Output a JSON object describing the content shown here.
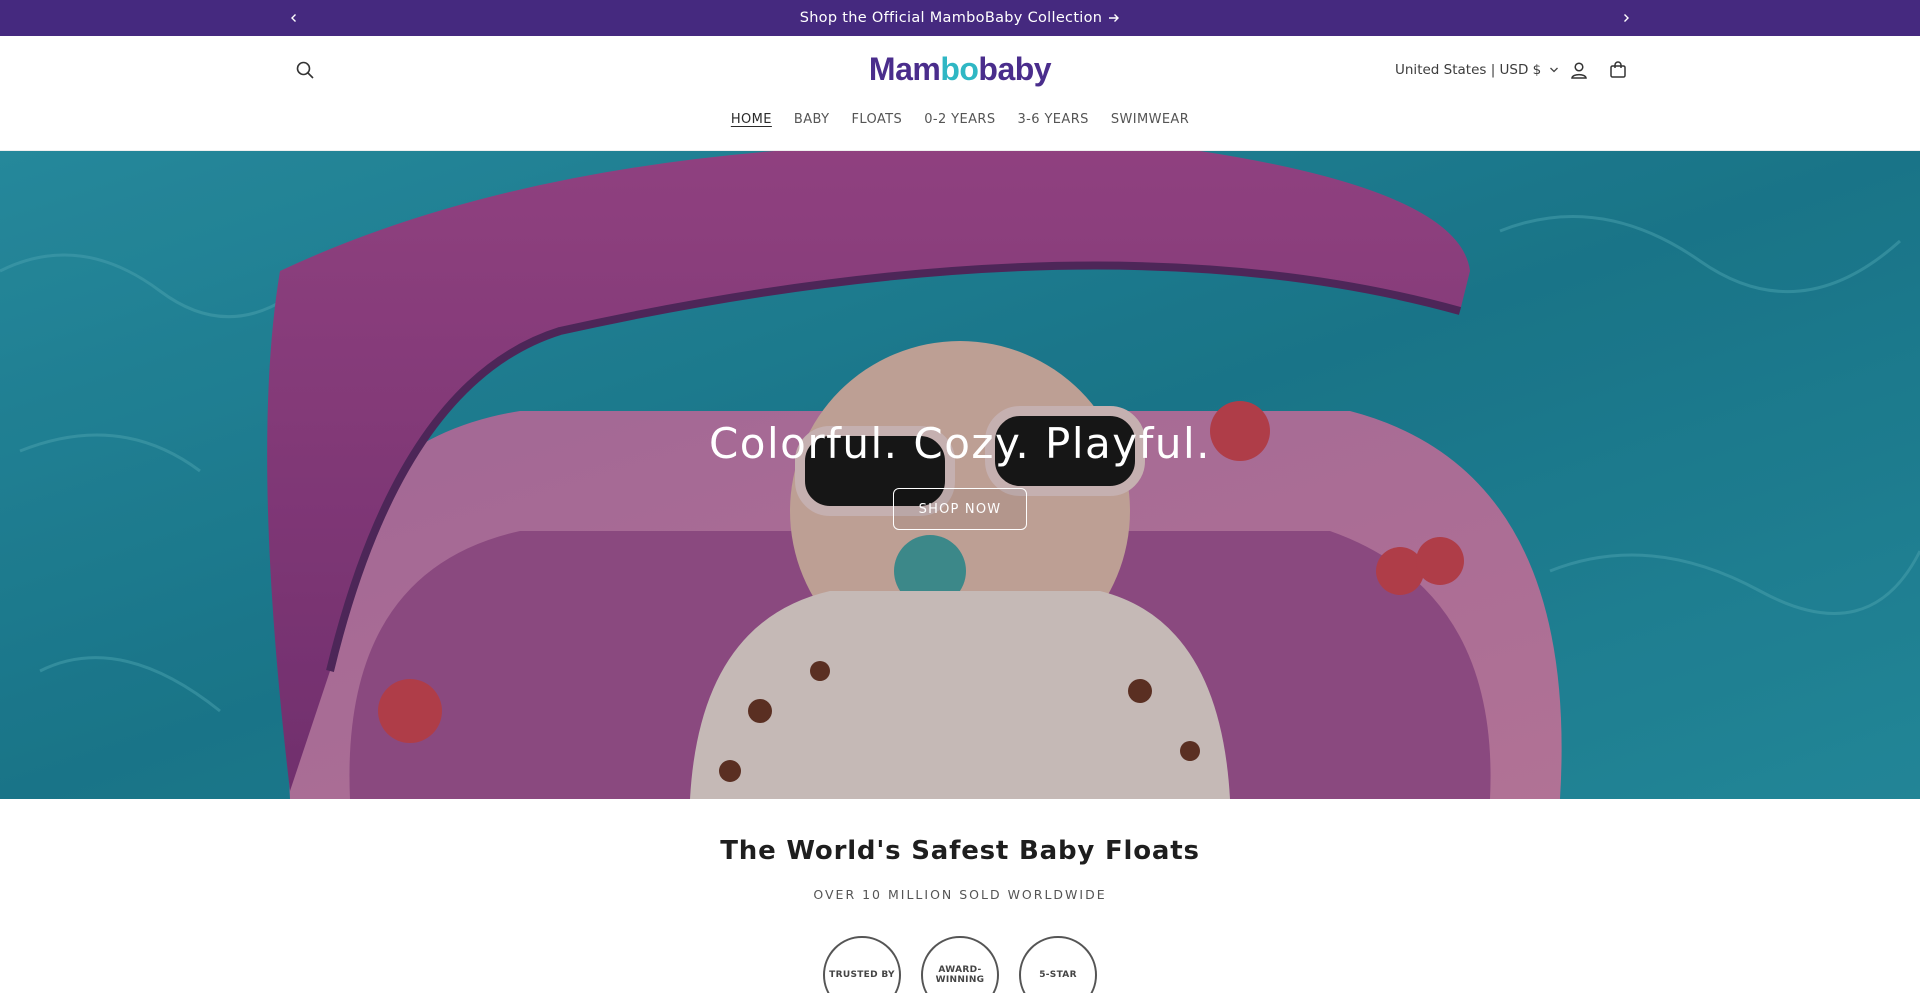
{
  "announcement": {
    "text": "Shop the Official MamboBaby Collection",
    "prev_icon": "chevron-left-icon",
    "next_icon": "chevron-right-icon"
  },
  "header": {
    "logo": {
      "part1": "Mam",
      "part2": "bo",
      "part3": "baby"
    },
    "country_selector": "United States | USD $",
    "icons": [
      "search-icon",
      "account-icon",
      "cart-icon"
    ]
  },
  "nav": {
    "items": [
      "HOME",
      "BABY",
      "FLOATS",
      "0-2 YEARS",
      "3-6 YEARS",
      "SWIMWEAR"
    ],
    "active": "HOME"
  },
  "hero": {
    "title": "Colorful. Cozy. Playful.",
    "button": "SHOP NOW"
  },
  "section": {
    "title": "The World's Safest Baby Floats",
    "subtitle": "OVER 10 MILLION SOLD WORLDWIDE",
    "badges": [
      "TRUSTED BY",
      "AWARD-WINNING",
      "5-STAR"
    ]
  },
  "colors": {
    "announcement_bg": "#45297f",
    "logo_purple": "#4a2d8c",
    "logo_teal": "#2fb7c4"
  }
}
